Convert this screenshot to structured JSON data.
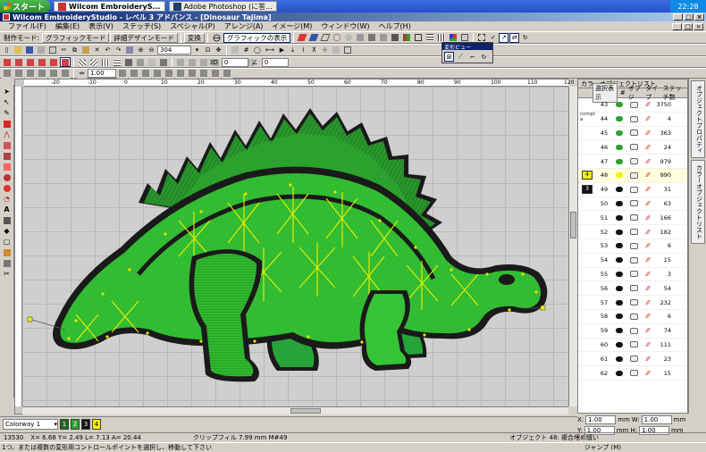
{
  "taskbar": {
    "start_label": "スタート",
    "tasks": [
      {
        "label": "Wilcom EmbroideryS...",
        "active": true
      },
      {
        "label": "Adobe Photoshop (に答...",
        "active": false
      }
    ],
    "clock": "22:28"
  },
  "window": {
    "title": "Wilcom EmbroideryStudio - レベル 3 アドバンス - [Dinosaur     Tajima]"
  },
  "menubar": {
    "items": [
      "ファイル(F)",
      "編集(E)",
      "表示(V)",
      "ステッチ(S)",
      "スペシャル(P)",
      "アレンジ(A)",
      "イメージ(M)",
      "ウィンドウ(W)",
      "ヘルプ(H)"
    ]
  },
  "toolbar_modes": {
    "production_label": "制作モード:",
    "graphic_mode": "グラフィックモード",
    "detail_design_mode": "詳細デザインモード",
    "transform": "変換",
    "show_graphics": "グラフィックの表示"
  },
  "toolbar_std": {
    "zoom_value": "304"
  },
  "toolbar_props": {
    "angle_value": "0",
    "stitch_value": "0",
    "spacing_value": "1.00"
  },
  "floatbox": {
    "title": "変形ビュー"
  },
  "panel": {
    "title": "カラーオブジェクトリスト",
    "show_button": "選択表示",
    "columns": [
      "#",
      "オブジ",
      "タイプ",
      "ステッチ数"
    ],
    "side_label_top": "compl",
    "side_label_bottom": "a",
    "objects": [
      {
        "num": "43",
        "color": "#2e9e2e",
        "stitches": "3750"
      },
      {
        "num": "44",
        "color": "#2e9e2e",
        "stitches": "4"
      },
      {
        "num": "45",
        "color": "#2e9e2e",
        "stitches": "363"
      },
      {
        "num": "46",
        "color": "#2e9e2e",
        "stitches": "24"
      },
      {
        "num": "47",
        "color": "#2e9e2e",
        "stitches": "979"
      },
      {
        "num": "48",
        "color": "#f2f200",
        "stitches": "990",
        "swatch": "4"
      },
      {
        "num": "49",
        "color": "#111111",
        "stitches": "31",
        "swatch": "3"
      },
      {
        "num": "50",
        "color": "#111111",
        "stitches": "63"
      },
      {
        "num": "51",
        "color": "#111111",
        "stitches": "166"
      },
      {
        "num": "52",
        "color": "#111111",
        "stitches": "182"
      },
      {
        "num": "53",
        "color": "#111111",
        "stitches": "6"
      },
      {
        "num": "54",
        "color": "#111111",
        "stitches": "15"
      },
      {
        "num": "55",
        "color": "#111111",
        "stitches": "3"
      },
      {
        "num": "56",
        "color": "#111111",
        "stitches": "54"
      },
      {
        "num": "57",
        "color": "#111111",
        "stitches": "232"
      },
      {
        "num": "58",
        "color": "#111111",
        "stitches": "6"
      },
      {
        "num": "59",
        "color": "#111111",
        "stitches": "74"
      },
      {
        "num": "60",
        "color": "#111111",
        "stitches": "111"
      },
      {
        "num": "61",
        "color": "#111111",
        "stitches": "23"
      },
      {
        "num": "62",
        "color": "#111111",
        "stitches": "15"
      }
    ]
  },
  "sidetabs": [
    "オブジェクトプロパティ",
    "カラーオブジェクトリスト"
  ],
  "colorbar": {
    "colorway": "Colorway 1",
    "swatches": [
      {
        "label": "1",
        "color": "#1a6b1a"
      },
      {
        "label": "2",
        "color": "#2e9e2e"
      },
      {
        "label": "3",
        "color": "#111111"
      },
      {
        "label": "4",
        "color": "#f2f200"
      }
    ]
  },
  "xyform": {
    "x_label": "X:",
    "x_value": "1.00",
    "x_unit": "mm",
    "w_label": "W:",
    "w_value": "1.00",
    "w_unit": "mm",
    "y_label": "Y:",
    "y_value": "1.00",
    "y_unit": "mm",
    "h_label": "H:",
    "h_value": "1.00",
    "h_unit": "mm"
  },
  "status": {
    "stitch_count": "13530",
    "coords": "X=  6.68  Y=  2.49  L=  7.13  A=  20.44",
    "clip": "クリップフィル  7.99 mm M#49",
    "object_info": "オブジェクト 48: 複合埋め縫い",
    "hint": "1つ、または複数の変形用コントロールポイントを選択し、移動して下さい",
    "jump": "ジャンプ (M)"
  },
  "ruler_labels": [
    "-20",
    "-10",
    "0",
    "10",
    "20",
    "30",
    "40",
    "50",
    "60",
    "70",
    "80",
    "90",
    "100",
    "110",
    "120"
  ],
  "colors": {
    "dark_green": "#1b7a1b",
    "mid_green": "#2fae2f",
    "body_green": "#35c435",
    "outline": "#1a1a1a",
    "yellow": "#f2f200"
  }
}
